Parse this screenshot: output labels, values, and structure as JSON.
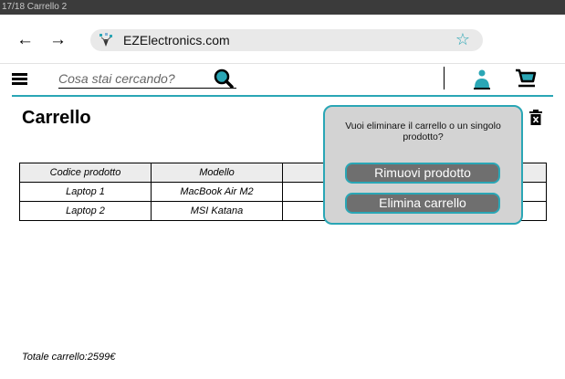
{
  "window": {
    "title": "17/18 Carrello 2"
  },
  "browser": {
    "back_icon": "arrow-left-icon",
    "forward_icon": "arrow-right-icon",
    "url": "EZElectronics.com",
    "bookmark_icon": "star-icon",
    "accent_color": "#2aa6b5"
  },
  "header": {
    "search_placeholder": "Cosa stai cercando?",
    "icons": [
      "menu-icon",
      "search-icon",
      "user-icon",
      "cart-icon"
    ]
  },
  "page": {
    "title": "Carrello",
    "trash_icon": "trash-icon"
  },
  "table": {
    "headers": [
      "Codice prodotto",
      "Modello",
      ""
    ],
    "rows": [
      [
        "Laptop 1",
        "MacBook Air M2",
        ""
      ],
      [
        "Laptop 2",
        "MSI Katana",
        ""
      ]
    ]
  },
  "popup": {
    "message": "Vuoi eliminare il carrello o un singolo prodotto?",
    "remove_product_label": "Rimuovi prodotto",
    "empty_cart_label": "Elimina carrello"
  },
  "footer": {
    "total": "Totale carrello:2599€"
  }
}
